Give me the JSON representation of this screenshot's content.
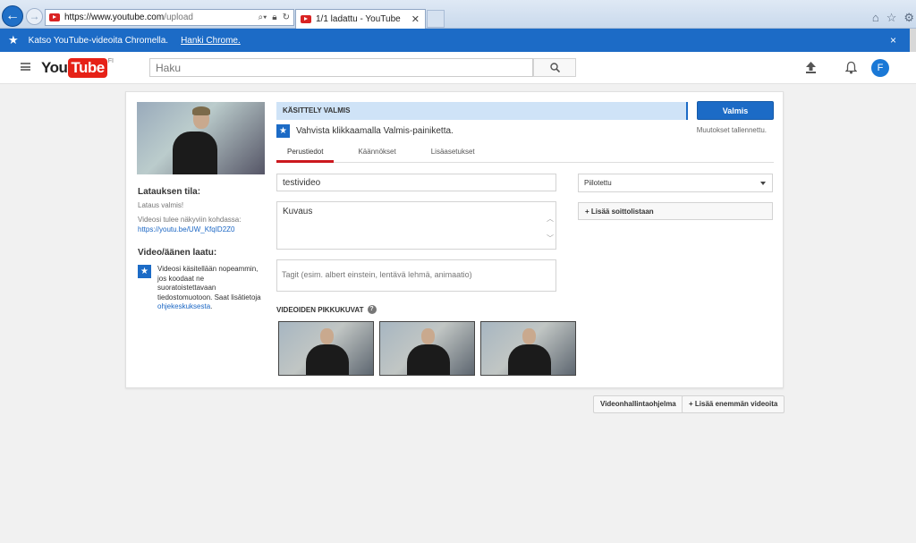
{
  "browser": {
    "url_host": "https://www.youtube.com",
    "url_path": "/upload",
    "tab_title": "1/1 ladattu - YouTube"
  },
  "promo": {
    "text": "Katso YouTube-videoita Chromella.",
    "link": "Hanki Chrome.",
    "close": "×"
  },
  "header": {
    "logo_you": "You",
    "logo_tube": "Tube",
    "logo_country": "FI",
    "search_placeholder": "Haku",
    "avatar_letter": "F"
  },
  "upload": {
    "status_label": "Latauksen tila:",
    "status_value": "Lataus valmis!",
    "url_intro": "Videosi tulee näkyviin kohdassa:",
    "video_url": "https://youtu.be/UW_KfqID2Z0",
    "quality_label": "Video/äänen laatu:",
    "quality_text": "Videosi käsitellään nopeammin, jos koodaat ne suoratoistettavaan tiedostomuotoon. Saat lisätietoja",
    "quality_link": "ohjekeskuksesta",
    "quality_end": ".",
    "processing": "KÄSITTELY VALMIS",
    "done_button": "Valmis",
    "saved": "Muutokset tallennettu.",
    "confirm": "Vahvista klikkaamalla Valmis-painiketta.",
    "tabs": [
      "Perustiedot",
      "Käännökset",
      "Lisäasetukset"
    ],
    "title_value": "testivideo",
    "description_placeholder": "Kuvaus",
    "tags_placeholder": "Tagit (esim. albert einstein, lentävä lehmä, animaatio)",
    "privacy_value": "Piilotettu",
    "playlist_button": "+ Lisää soittolistaan",
    "thumbnails_label": "VIDEOIDEN PIKKUKUVAT"
  },
  "footer": {
    "manager_button": "Videonhallintaohjelma",
    "add_more_button": "+ Lisää enemmän videoita"
  }
}
